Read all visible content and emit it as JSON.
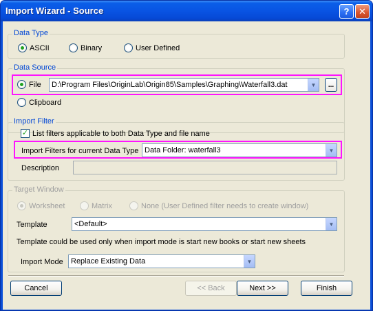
{
  "window": {
    "title": "Import Wizard - Source",
    "help_glyph": "?",
    "close_glyph": "✕"
  },
  "data_type": {
    "title": "Data Type",
    "options": [
      {
        "label": "ASCII",
        "selected": true
      },
      {
        "label": "Binary",
        "selected": false
      },
      {
        "label": "User Defined",
        "selected": false
      }
    ]
  },
  "data_source": {
    "title": "Data Source",
    "file_label": "File",
    "file_path": "D:\\Program Files\\OriginLab\\Origin85\\Samples\\Graphing\\Waterfall3.dat",
    "browse_label": "...",
    "clipboard_label": "Clipboard",
    "selected": "file"
  },
  "import_filter": {
    "title": "Import Filter",
    "list_filters_label": "List filters applicable to both Data Type and file name",
    "list_filters_checked": true,
    "filters_label": "Import Filters for current Data Type",
    "filters_value": "Data Folder: waterfall3",
    "description_label": "Description",
    "description_value": ""
  },
  "target_window": {
    "title": "Target Window",
    "options": [
      {
        "label": "Worksheet",
        "selected": true
      },
      {
        "label": "Matrix",
        "selected": false
      },
      {
        "label": "None (User Defined filter needs to create window)",
        "selected": false
      }
    ],
    "template_label": "Template",
    "template_value": "<Default>",
    "template_note": "Template could be used only when import mode is start new books or start new sheets",
    "import_mode_label": "Import Mode",
    "import_mode_value": "Replace Existing Data"
  },
  "buttons": {
    "cancel": "Cancel",
    "back": "<< Back",
    "next": "Next >>",
    "finish": "Finish"
  },
  "colors": {
    "title_bar": "#0a5ee8",
    "group_title": "#0046d5",
    "highlight": "#ff14ff",
    "dialog_bg": "#ece9d8"
  }
}
